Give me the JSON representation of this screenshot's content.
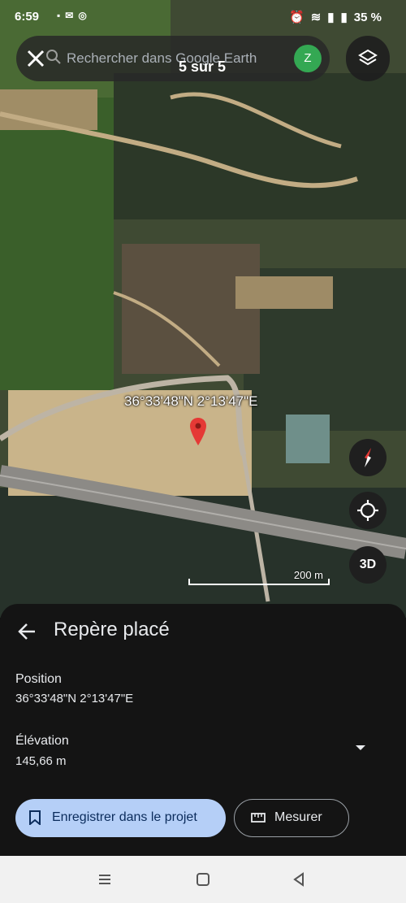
{
  "status_bar": {
    "time": "6:59",
    "battery": "35 %"
  },
  "search": {
    "placeholder": "Rechercher dans Google Earth",
    "result_count": "5 sur 5",
    "avatar_letter": "Z"
  },
  "map": {
    "coordinate_label": "36°33'48\"N 2°13'47\"E",
    "scale_label": "200 m",
    "button_3d": "3D"
  },
  "sheet": {
    "title": "Repère placé",
    "position_label": "Position",
    "position_value": "36°33'48\"N 2°13'47\"E",
    "elevation_label": "Élévation",
    "elevation_value": "145,66 m",
    "save_button": "Enregistrer dans le projet",
    "measure_button": "Mesurer"
  },
  "colors": {
    "pin": "#e53935",
    "save_bg": "#b5cff7",
    "avatar_bg": "#34a853",
    "sheet_bg": "#141414"
  }
}
